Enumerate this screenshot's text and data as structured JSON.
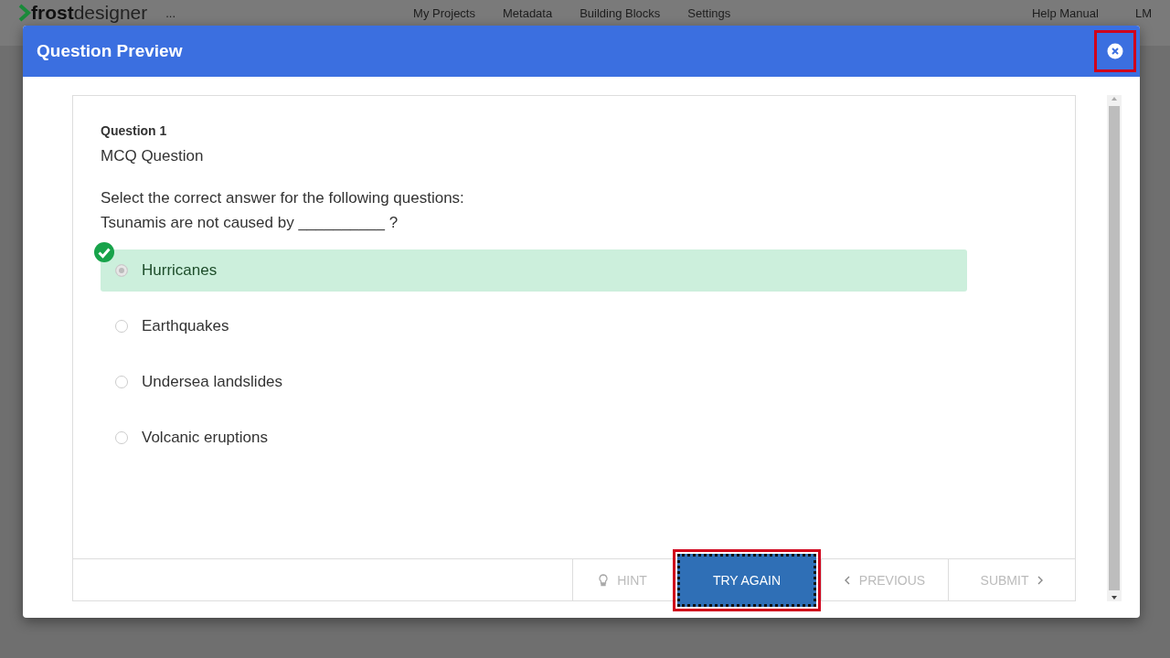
{
  "app_header": {
    "logo_bold": "frost",
    "logo_light": "designer",
    "more": "...",
    "nav": [
      "My Projects",
      "Metadata",
      "Building Blocks",
      "Settings"
    ],
    "help": "Help Manual",
    "user": "LM"
  },
  "dialog": {
    "title": "Question Preview",
    "close_highlighted": true
  },
  "question": {
    "number": "Question 1",
    "type": "MCQ Question",
    "prompt": "Select the correct answer for the following questions:",
    "stem": "Tsunamis are not caused by __________ ?",
    "options": [
      {
        "label": "Hurricanes",
        "correct": true
      },
      {
        "label": "Earthquakes",
        "correct": false
      },
      {
        "label": "Undersea landslides",
        "correct": false
      },
      {
        "label": "Volcanic eruptions",
        "correct": false
      }
    ]
  },
  "footer": [
    {
      "kind": "hint",
      "label": "HINT",
      "disabled": true,
      "highlighted": false
    },
    {
      "kind": "primary",
      "label": "TRY AGAIN",
      "disabled": false,
      "highlighted": true
    },
    {
      "kind": "previous",
      "label": "PREVIOUS",
      "disabled": true,
      "highlighted": false
    },
    {
      "kind": "submit",
      "label": "SUBMIT",
      "disabled": true,
      "highlighted": false
    }
  ]
}
